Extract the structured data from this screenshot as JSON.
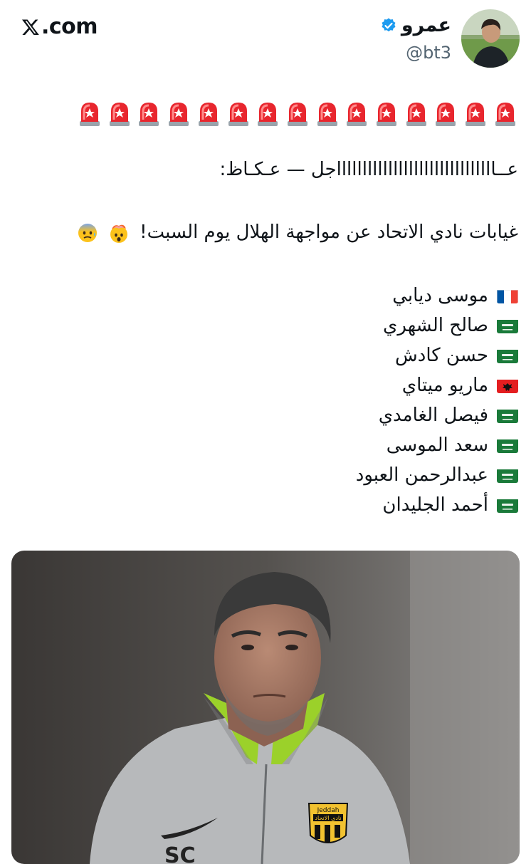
{
  "brand": {
    "logo_text": ".com",
    "icon": "x-logo-icon"
  },
  "author": {
    "display_name": "عمرو",
    "handle": "@bt3",
    "verified_color": "#1d9bf0"
  },
  "tweet": {
    "siren_count": 15,
    "siren_icon": "police-light-icon",
    "line1": "عــاااااااااااااااااااااااااااااااجل — عـكـاظ:",
    "line2": "غيابات نادي الاتحاد عن مواجهة الهلال يوم السبت!",
    "line2_emojis": [
      "exploding-head-icon",
      "anxious-face-icon"
    ],
    "players": [
      {
        "name": "موسى ديابي",
        "flag": "france"
      },
      {
        "name": "صالح الشهري",
        "flag": "saudi"
      },
      {
        "name": "حسن كادش",
        "flag": "saudi"
      },
      {
        "name": "ماريو ميتاي",
        "flag": "albania"
      },
      {
        "name": "فيصل الغامدي",
        "flag": "saudi"
      },
      {
        "name": "سعد الموسى",
        "flag": "saudi"
      },
      {
        "name": "عبدالرحمن العبود",
        "flag": "saudi"
      },
      {
        "name": "أحمد الجليدان",
        "flag": "saudi"
      }
    ],
    "photo": {
      "jacket_initials": "SC",
      "crest_text": "نادي الاتحاد",
      "crest_top": "Jeddah"
    }
  }
}
